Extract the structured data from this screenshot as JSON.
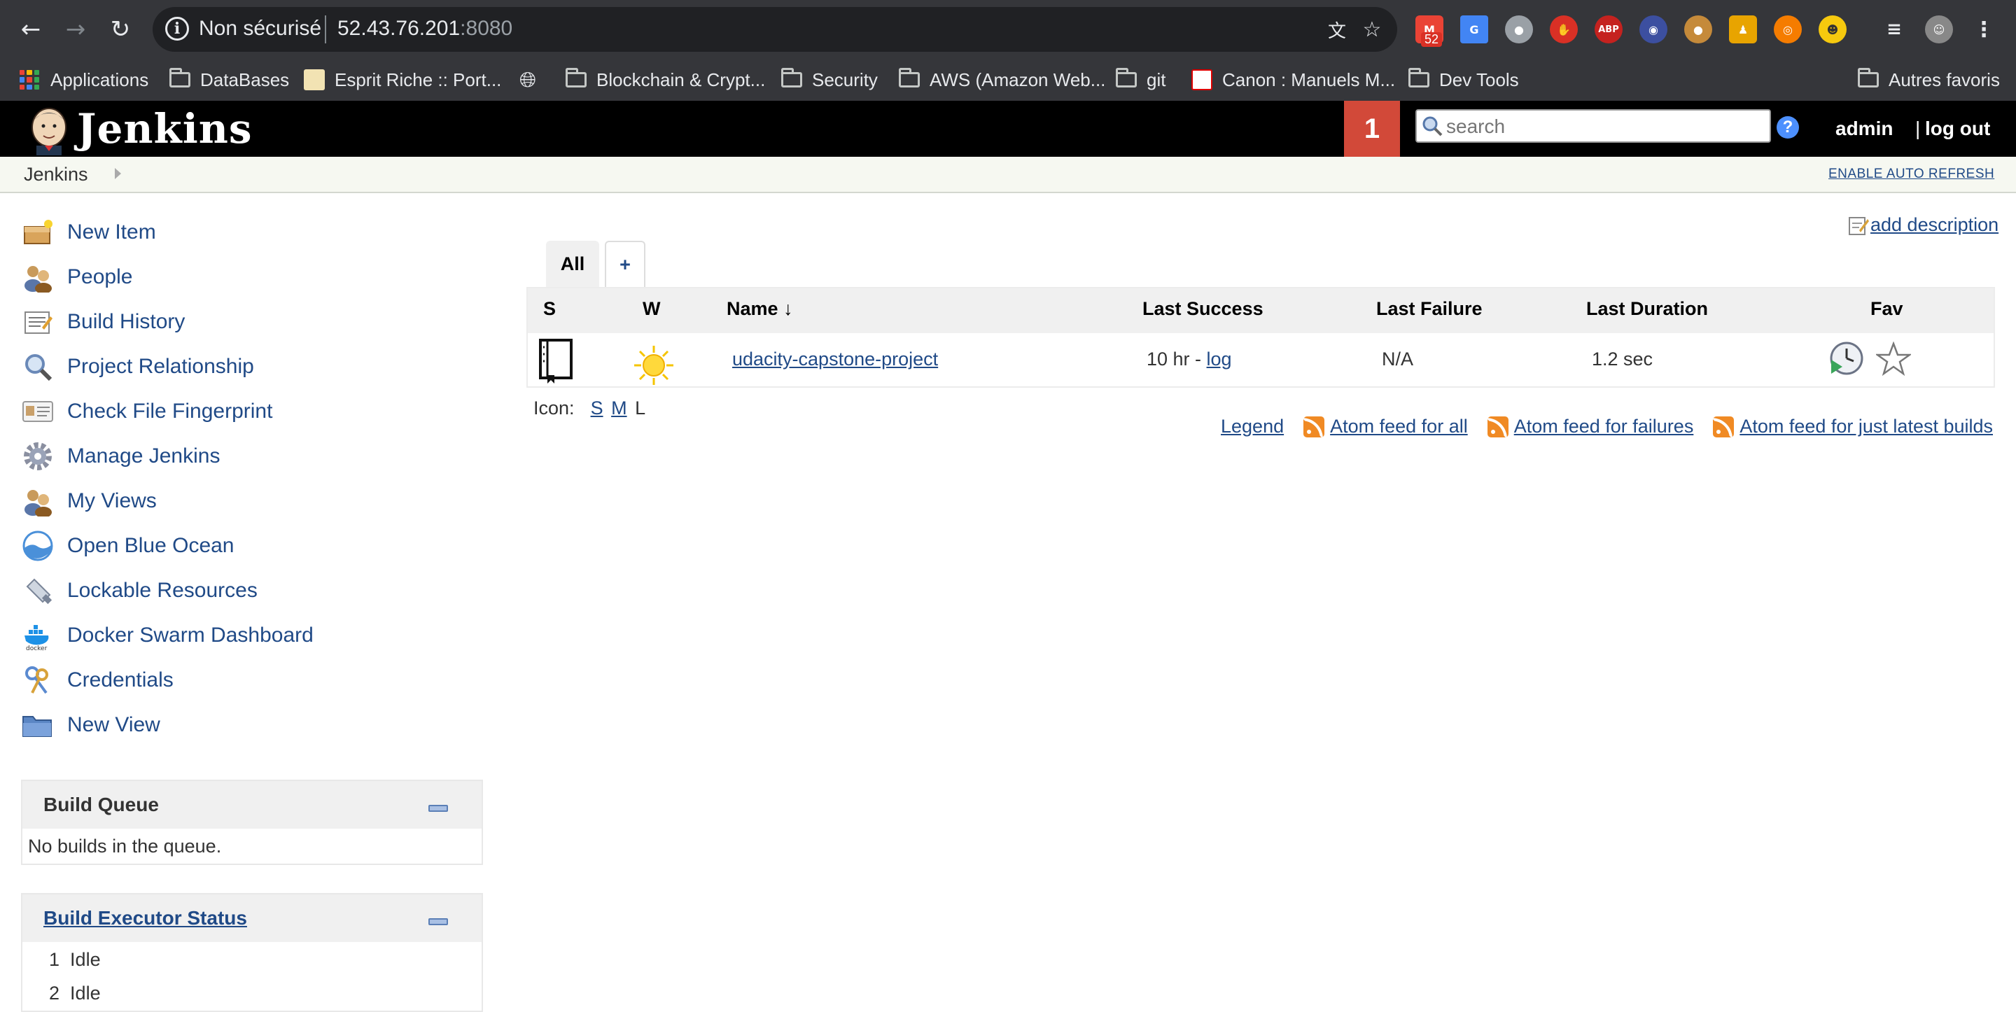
{
  "browser": {
    "security_label": "Non sécurisé",
    "url_host": "52.43.76.201",
    "url_port": ":8080",
    "notification_count": "52",
    "bookmarks": [
      {
        "label": "Applications",
        "icon": "apps-grid-icon"
      },
      {
        "label": "DataBases",
        "icon": "folder-icon"
      },
      {
        "label": "Esprit Riche :: Port...",
        "icon": "site-favicon"
      },
      {
        "label": "",
        "icon": "globe-icon"
      },
      {
        "label": "Blockchain & Crypt...",
        "icon": "folder-icon"
      },
      {
        "label": "Security",
        "icon": "folder-icon"
      },
      {
        "label": "AWS (Amazon Web...",
        "icon": "folder-icon"
      },
      {
        "label": "git",
        "icon": "folder-icon"
      },
      {
        "label": "Canon : Manuels M...",
        "icon": "canon-favicon"
      },
      {
        "label": "Dev Tools",
        "icon": "folder-icon"
      },
      {
        "label": "Autres favoris",
        "icon": "folder-icon"
      }
    ]
  },
  "jenkins": {
    "title": "Jenkins",
    "notification_badge": "1",
    "search_placeholder": "search",
    "help": "?",
    "user": "admin",
    "separator": "|",
    "logout": "log out",
    "breadcrumb": "Jenkins",
    "auto_refresh": "ENABLE AUTO REFRESH",
    "add_description": "add description"
  },
  "sidebar": {
    "tasks": [
      {
        "label": "New Item",
        "icon": "new-item-icon"
      },
      {
        "label": "People",
        "icon": "people-icon"
      },
      {
        "label": "Build History",
        "icon": "build-history-icon"
      },
      {
        "label": "Project Relationship",
        "icon": "search-icon"
      },
      {
        "label": "Check File Fingerprint",
        "icon": "fingerprint-icon"
      },
      {
        "label": "Manage Jenkins",
        "icon": "gear-icon"
      },
      {
        "label": "My Views",
        "icon": "people-icon"
      },
      {
        "label": "Open Blue Ocean",
        "icon": "blue-ocean-icon"
      },
      {
        "label": "Lockable Resources",
        "icon": "usb-icon"
      },
      {
        "label": "Docker Swarm Dashboard",
        "icon": "docker-icon"
      },
      {
        "label": "Credentials",
        "icon": "keys-icon"
      },
      {
        "label": "New View",
        "icon": "folder-icon"
      }
    ],
    "build_queue": {
      "title": "Build Queue",
      "empty": "No builds in the queue."
    },
    "executors": {
      "title": "Build Executor Status",
      "rows": [
        {
          "num": "1",
          "status": "Idle"
        },
        {
          "num": "2",
          "status": "Idle"
        }
      ]
    }
  },
  "views": {
    "tabs": [
      {
        "label": "All",
        "active": true
      }
    ],
    "add_tab": "+"
  },
  "table": {
    "headers": {
      "s": "S",
      "w": "W",
      "name": "Name",
      "sort": "↓",
      "last_success": "Last Success",
      "last_failure": "Last Failure",
      "last_duration": "Last Duration",
      "fav": "Fav"
    },
    "rows": [
      {
        "name": "udacity-capstone-project",
        "last_success": "10 hr - ",
        "last_success_link": "log",
        "last_failure": "N/A",
        "last_duration": "1.2 sec",
        "status_icon": "status-book-icon",
        "weather_icon": "sunny-icon"
      }
    ]
  },
  "footer": {
    "icon_label": "Icon:",
    "sizes": [
      "S",
      "M",
      "L"
    ],
    "legend": "Legend",
    "feed_all": "Atom feed for all",
    "feed_failures": "Atom feed for failures",
    "feed_latest": "Atom feed for just latest builds"
  },
  "colors": {
    "jenkins_header": "#000000",
    "badge": "#d24939",
    "link": "#204a87",
    "chrome_bg": "#35363a"
  }
}
